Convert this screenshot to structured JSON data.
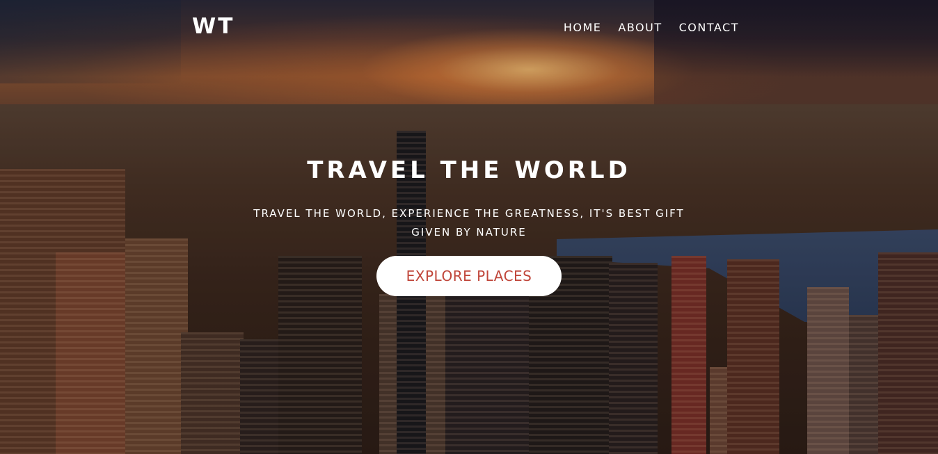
{
  "brand": {
    "logo_text": "WT"
  },
  "nav": {
    "items": [
      {
        "label": "HOME"
      },
      {
        "label": "ABOUT"
      },
      {
        "label": "CONTACT"
      }
    ]
  },
  "hero": {
    "title": "TRAVEL THE WORLD",
    "subtitle": "TRAVEL THE WORLD, EXPERIENCE THE GREATNESS, IT'S BEST GIFT GIVEN BY NATURE",
    "cta_label": "EXPLORE PLACES"
  },
  "colors": {
    "cta_text": "#c0463a",
    "cta_background": "#ffffff",
    "text": "#ffffff"
  }
}
